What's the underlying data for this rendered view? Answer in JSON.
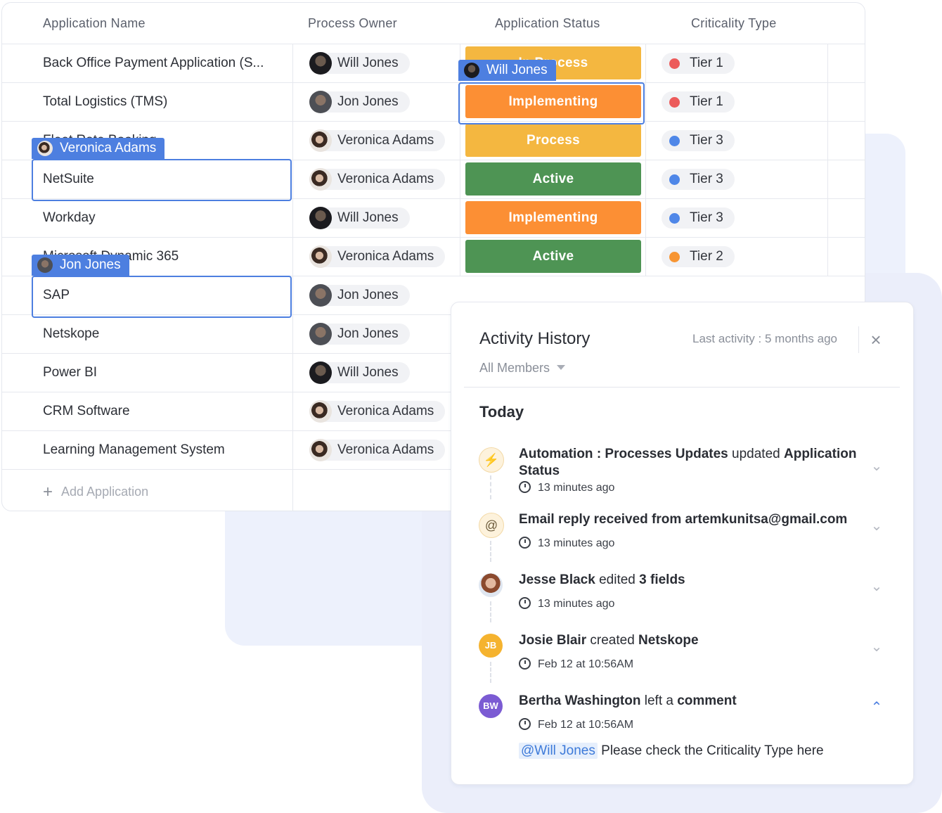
{
  "table": {
    "headers": [
      "Application Name",
      "Process Owner",
      "Application Status",
      "Criticality Type"
    ],
    "rows": [
      {
        "name": "Back Office Payment Application (S...",
        "owner": "Will Jones",
        "status": "In Process",
        "tier": "Tier 1"
      },
      {
        "name": "Total Logistics (TMS)",
        "owner": "Jon Jones",
        "status": "Implementing",
        "tier": "Tier 1"
      },
      {
        "name": "Fleet Rate Booking",
        "owner": "Veronica Adams",
        "status": "Process",
        "tier": "Tier 3"
      },
      {
        "name": "NetSuite",
        "owner": "Veronica Adams",
        "status": "Active",
        "tier": "Tier 3"
      },
      {
        "name": "Workday",
        "owner": "Will Jones",
        "status": "Implementing",
        "tier": "Tier 3"
      },
      {
        "name": "Microsoft Dynamic 365",
        "owner": "Veronica Adams",
        "status": "Active",
        "tier": "Tier 2"
      },
      {
        "name": "SAP",
        "owner": "Jon Jones",
        "status": "",
        "tier": ""
      },
      {
        "name": "Netskope",
        "owner": "Jon Jones",
        "status": "",
        "tier": ""
      },
      {
        "name": "Power BI",
        "owner": "Will Jones",
        "status": "",
        "tier": ""
      },
      {
        "name": "CRM Software",
        "owner": "Veronica Adams",
        "status": "",
        "tier": ""
      },
      {
        "name": "Learning Management System",
        "owner": "Veronica Adams",
        "status": "",
        "tier": ""
      }
    ],
    "add_label": "Add Application"
  },
  "cursors": {
    "will": "Will Jones",
    "veronica": "Veronica Adams",
    "jon": "Jon Jones"
  },
  "colors": {
    "in_process": "#f4b740",
    "process": "#f4b740",
    "implementing": "#fc8f34",
    "active": "#4e9454",
    "tier1": "#ec5b5b",
    "tier2": "#f79533",
    "tier3": "#4f87e8",
    "cursor": "#4d7fe0"
  },
  "activity": {
    "title": "Activity History",
    "last_activity": "Last activity : 5 months ago",
    "filter": "All Members",
    "section": "Today",
    "items": [
      {
        "icon": "lightning-icon",
        "time": "13 minutes ago"
      },
      {
        "icon": "at-sign-icon",
        "time": "13 minutes ago"
      },
      {
        "icon": "avatar",
        "time": "13 minutes ago"
      },
      {
        "initials": "JB",
        "time": "Feb 12 at 10:56AM"
      },
      {
        "initials": "BW",
        "time": "Feb 12 at 10:56AM"
      }
    ],
    "texts": {
      "i1_a": "Automation : Processes Updates",
      "i1_b": " updated ",
      "i1_c": "Application Status",
      "i2_a": "Email reply received from artemkunitsa@gmail.com",
      "i3_a": "Jesse Black",
      "i3_b": " edited ",
      "i3_c": "3 fields",
      "i4_a": "Josie Blair",
      "i4_b": " created ",
      "i4_c": "Netskope",
      "i5_a": "Bertha Washington",
      "i5_b": " left a ",
      "i5_c": "comment"
    },
    "comment_mention": "@Will Jones",
    "comment_body": "Please check the Criticality Type here"
  }
}
